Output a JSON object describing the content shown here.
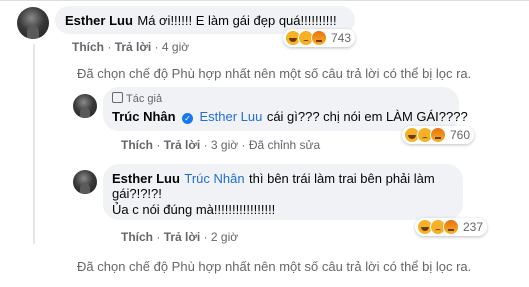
{
  "comment1": {
    "name": "Esther Luu",
    "text": "Má ơi!!!!!! E làm gái đẹp quá!!!!!!!!!!",
    "actions": {
      "like": "Thích",
      "reply": "Trả lời",
      "time": "4 giờ"
    },
    "reaction_count": "743"
  },
  "filter_notice_1": "Đã chọn chế độ Phù hợp nhất nên một số câu trả lời có thể bị lọc ra.",
  "reply1": {
    "author_tag": "Tác giả",
    "name": "Trúc Nhân",
    "mention": "Esther Luu",
    "text": "cái gì??? chị nói em LÀM GÁI????",
    "actions": {
      "like": "Thích",
      "reply": "Trả lời",
      "time": "3 giờ",
      "edited": "Đã chỉnh sửa"
    },
    "reaction_count": "760"
  },
  "reply2": {
    "name": "Esther Luu",
    "mention": "Trúc Nhân",
    "text_line1": "thì bên trái làm trai bên phải làm",
    "text_line2": "gái?!?!?!",
    "text_line3": "Ủa c nói đúng mà!!!!!!!!!!!!!!!!!",
    "actions": {
      "like": "Thích",
      "reply": "Trả lời",
      "time": "2 giờ"
    },
    "reaction_count": "237"
  },
  "filter_notice_2": "Đã chọn chế độ Phù hợp nhất nên một số câu trả lời có thể bị lọc ra.",
  "colors": {
    "mention": "#216fdb",
    "meta": "#65676b",
    "bubble": "#f0f2f5",
    "verified": "#1877f2"
  },
  "icons": [
    "avatar",
    "haha-icon",
    "sad-icon",
    "angry-icon",
    "verified-badge-icon",
    "author-tag-icon"
  ]
}
